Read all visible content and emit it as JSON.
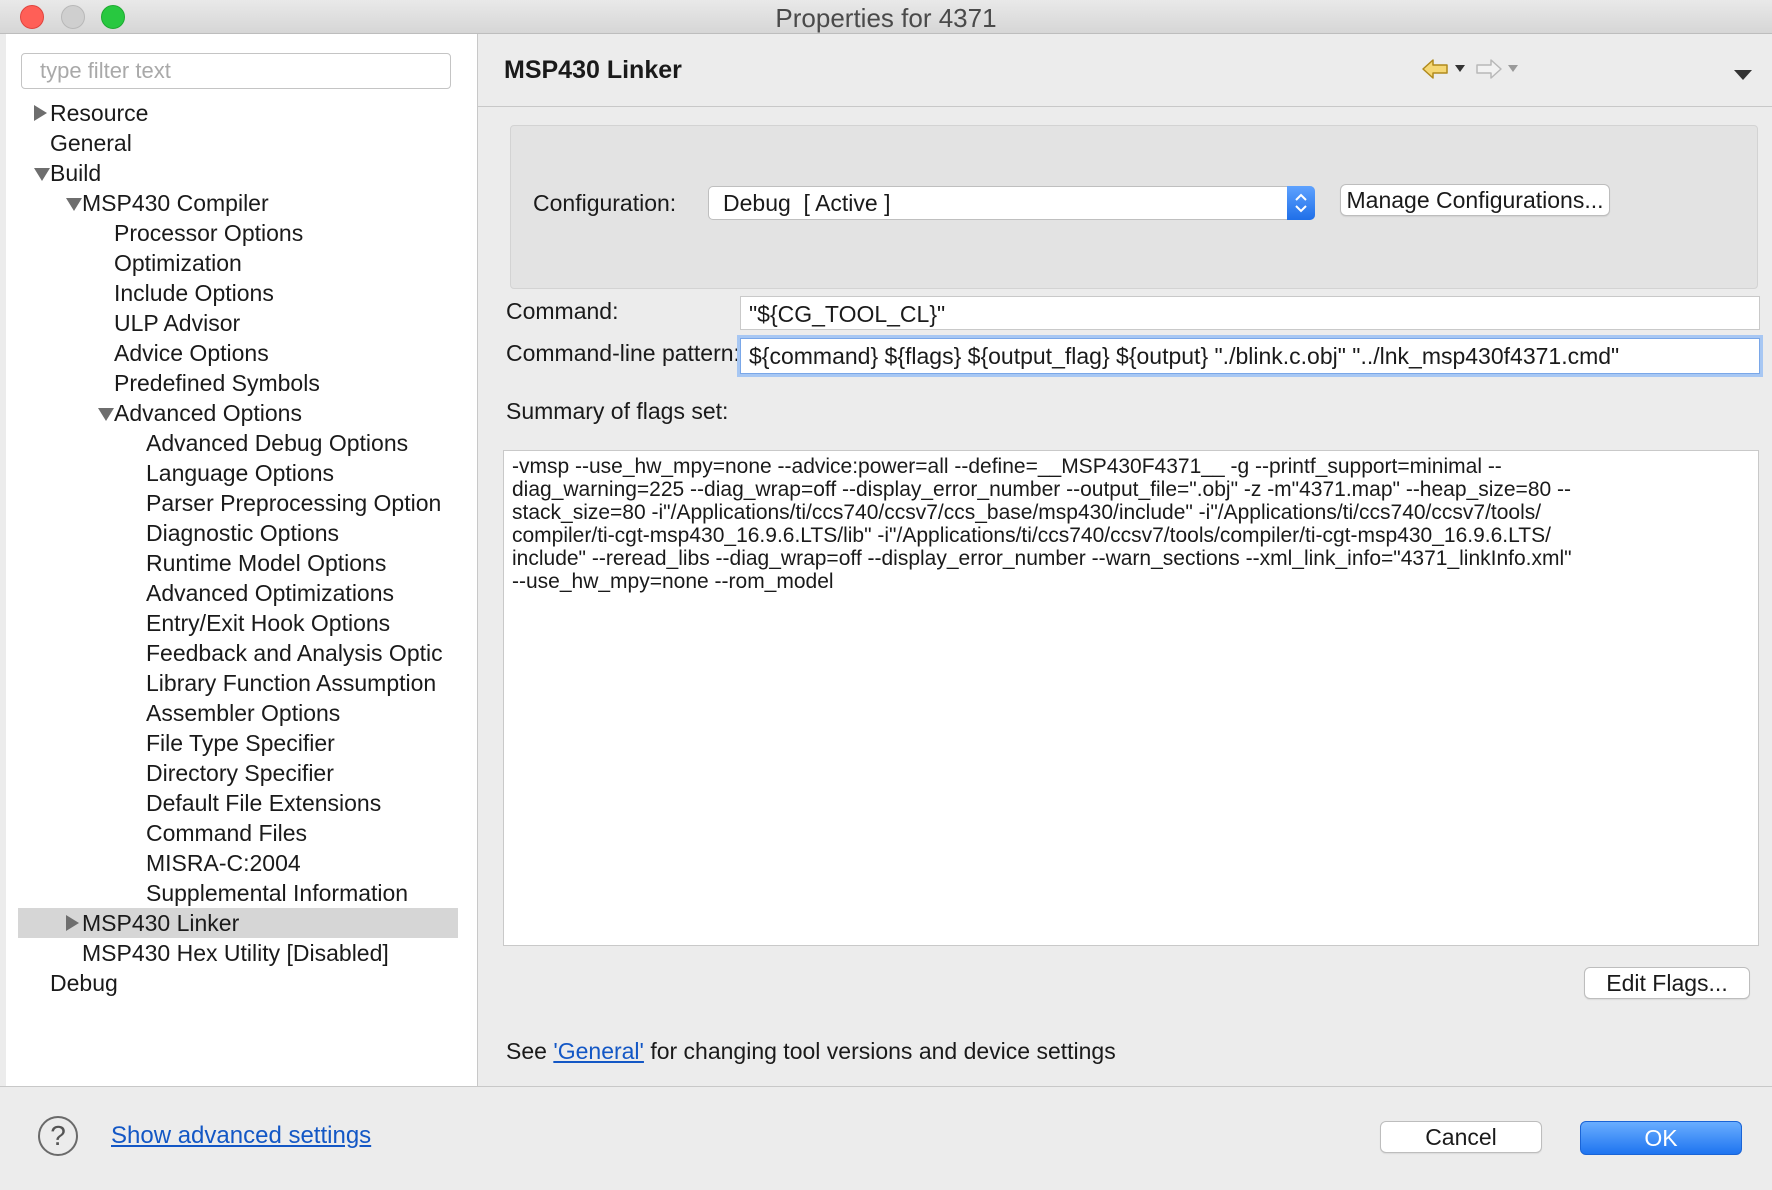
{
  "window": {
    "title": "Properties for 4371"
  },
  "sidebar": {
    "filter_placeholder": "type filter text",
    "tree": [
      {
        "label": "Resource",
        "level": 0,
        "twisty": "collapsed",
        "selected": false
      },
      {
        "label": "General",
        "level": 0,
        "twisty": "none",
        "selected": false
      },
      {
        "label": "Build",
        "level": 0,
        "twisty": "expanded",
        "selected": false
      },
      {
        "label": "MSP430 Compiler",
        "level": 1,
        "twisty": "expanded",
        "selected": false
      },
      {
        "label": "Processor Options",
        "level": 2,
        "twisty": "none",
        "selected": false
      },
      {
        "label": "Optimization",
        "level": 2,
        "twisty": "none",
        "selected": false
      },
      {
        "label": "Include Options",
        "level": 2,
        "twisty": "none",
        "selected": false
      },
      {
        "label": "ULP Advisor",
        "level": 2,
        "twisty": "none",
        "selected": false
      },
      {
        "label": "Advice Options",
        "level": 2,
        "twisty": "none",
        "selected": false
      },
      {
        "label": "Predefined Symbols",
        "level": 2,
        "twisty": "none",
        "selected": false
      },
      {
        "label": "Advanced Options",
        "level": 2,
        "twisty": "expanded",
        "selected": false
      },
      {
        "label": "Advanced Debug Options",
        "level": 3,
        "twisty": "none",
        "selected": false
      },
      {
        "label": "Language Options",
        "level": 3,
        "twisty": "none",
        "selected": false
      },
      {
        "label": "Parser Preprocessing Option",
        "level": 3,
        "twisty": "none",
        "selected": false
      },
      {
        "label": "Diagnostic Options",
        "level": 3,
        "twisty": "none",
        "selected": false
      },
      {
        "label": "Runtime Model Options",
        "level": 3,
        "twisty": "none",
        "selected": false
      },
      {
        "label": "Advanced Optimizations",
        "level": 3,
        "twisty": "none",
        "selected": false
      },
      {
        "label": "Entry/Exit Hook Options",
        "level": 3,
        "twisty": "none",
        "selected": false
      },
      {
        "label": "Feedback and Analysis Optic",
        "level": 3,
        "twisty": "none",
        "selected": false
      },
      {
        "label": "Library Function Assumption",
        "level": 3,
        "twisty": "none",
        "selected": false
      },
      {
        "label": "Assembler Options",
        "level": 3,
        "twisty": "none",
        "selected": false
      },
      {
        "label": "File Type Specifier",
        "level": 3,
        "twisty": "none",
        "selected": false
      },
      {
        "label": "Directory Specifier",
        "level": 3,
        "twisty": "none",
        "selected": false
      },
      {
        "label": "Default File Extensions",
        "level": 3,
        "twisty": "none",
        "selected": false
      },
      {
        "label": "Command Files",
        "level": 3,
        "twisty": "none",
        "selected": false
      },
      {
        "label": "MISRA-C:2004",
        "level": 3,
        "twisty": "none",
        "selected": false
      },
      {
        "label": "Supplemental Information",
        "level": 3,
        "twisty": "none",
        "selected": false
      },
      {
        "label": "MSP430 Linker",
        "level": 1,
        "twisty": "collapsed",
        "selected": true
      },
      {
        "label": "MSP430 Hex Utility  [Disabled]",
        "level": 1,
        "twisty": "none",
        "selected": false
      },
      {
        "label": "Debug",
        "level": 0,
        "twisty": "none",
        "selected": false
      }
    ]
  },
  "main": {
    "title": "MSP430 Linker",
    "nav_icons": {
      "back": "back-arrow-icon",
      "forward": "forward-arrow-icon",
      "menu": "view-menu-icon"
    },
    "configuration": {
      "label": "Configuration:",
      "value": "Debug  [ Active ]",
      "manage_label": "Manage Configurations..."
    },
    "command": {
      "label": "Command:",
      "value": "\"${CG_TOOL_CL}\""
    },
    "pattern": {
      "label": "Command-line pattern:",
      "value": "${command} ${flags} ${output_flag} ${output} \"./blink.c.obj\" \"../lnk_msp430f4371.cmd\""
    },
    "summary": {
      "label": "Summary of flags set:",
      "lines": [
        "-vmsp --use_hw_mpy=none --advice:power=all --define=__MSP430F4371__ -g --printf_support=minimal --",
        "diag_warning=225 --diag_wrap=off --display_error_number --output_file=\".obj\" -z -m\"4371.map\" --heap_size=80 --",
        "stack_size=80 -i\"/Applications/ti/ccs740/ccsv7/ccs_base/msp430/include\" -i\"/Applications/ti/ccs740/ccsv7/tools/",
        "compiler/ti-cgt-msp430_16.9.6.LTS/lib\" -i\"/Applications/ti/ccs740/ccsv7/tools/compiler/ti-cgt-msp430_16.9.6.LTS/",
        "include\" --reread_libs --diag_wrap=off --display_error_number --warn_sections --xml_link_info=\"4371_linkInfo.xml\"",
        "--use_hw_mpy=none --rom_model"
      ]
    },
    "edit_flags_label": "Edit Flags...",
    "footer": {
      "prefix": "See ",
      "link": "'General'",
      "suffix": " for changing tool versions and device settings"
    }
  },
  "bottom": {
    "help_icon": "help-icon",
    "help_glyph": "?",
    "advanced_link": "Show advanced settings",
    "cancel_label": "Cancel",
    "ok_label": "OK"
  },
  "colors": {
    "accent": "#1e74f0",
    "link": "#1357c5",
    "selection": "#d6d6d6"
  }
}
